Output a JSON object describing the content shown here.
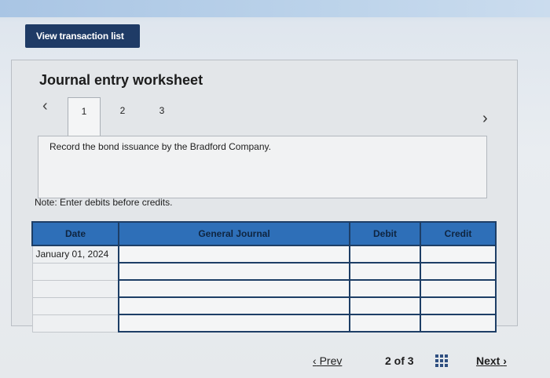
{
  "header": {
    "view_button_label": "View transaction list"
  },
  "worksheet": {
    "title": "Journal entry worksheet",
    "tabs": [
      "1",
      "2",
      "3"
    ],
    "instruction": "Record the bond issuance by the Bradford Company.",
    "note": "Note: Enter debits before credits."
  },
  "table": {
    "headers": {
      "date": "Date",
      "journal": "General Journal",
      "debit": "Debit",
      "credit": "Credit"
    },
    "first_date": "January 01, 2024"
  },
  "pager": {
    "prev": "Prev",
    "page_info": "2 of 3",
    "next": "Next"
  },
  "icons": {
    "prev_arrow": "chevron-left-icon",
    "next_arrow": "chevron-right-icon",
    "grid": "grid-icon"
  }
}
